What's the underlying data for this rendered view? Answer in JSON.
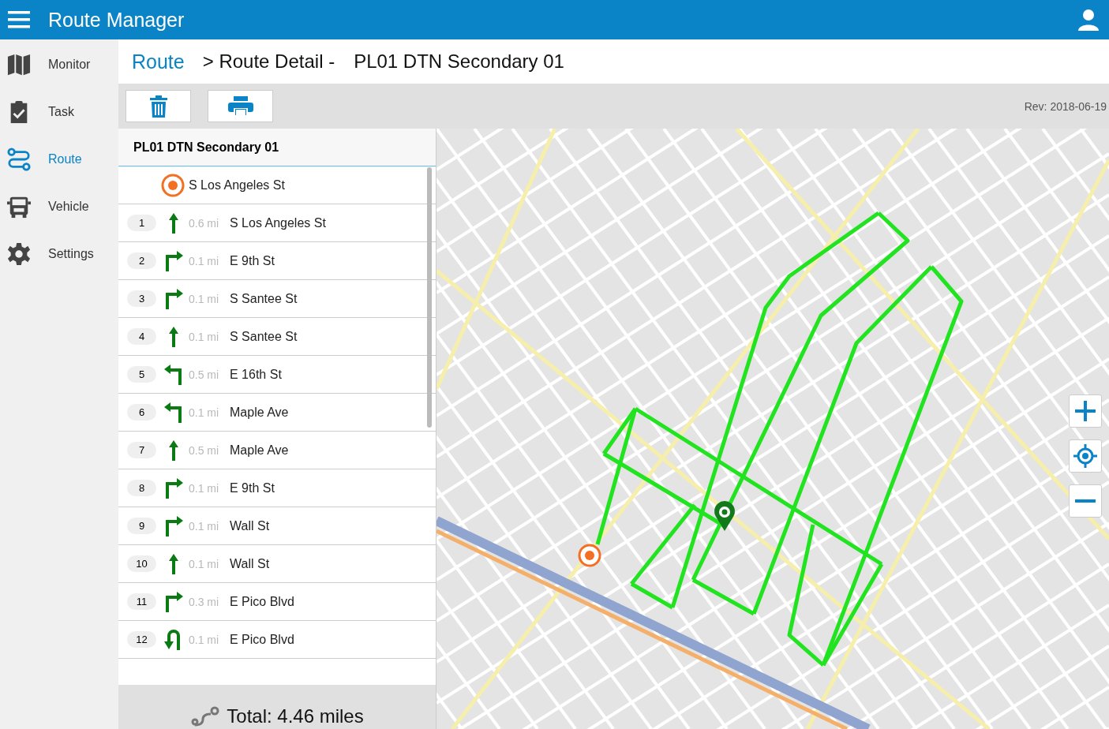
{
  "app": {
    "title": "Route Manager"
  },
  "nav": [
    {
      "label": "Monitor",
      "kind": "map",
      "selected": false
    },
    {
      "label": "Task",
      "kind": "task",
      "selected": false
    },
    {
      "label": "Route",
      "kind": "route",
      "selected": true
    },
    {
      "label": "Vehicle",
      "kind": "vehicle",
      "selected": false
    },
    {
      "label": "Settings",
      "kind": "settings",
      "selected": false
    }
  ],
  "breadcrumb": {
    "link": "Route",
    "separator": "> Route Detail -",
    "current": "PL01 DTN Secondary 01"
  },
  "toolbar": {
    "revision": "Rev: 2018-06-19"
  },
  "route": {
    "name": "PL01 DTN Secondary 01",
    "start": "S Los Angeles St",
    "steps": [
      {
        "number": "1",
        "kind": "straight",
        "distance": "0.6 mi",
        "street": "S Los Angeles St"
      },
      {
        "number": "2",
        "kind": "right",
        "distance": "0.1 mi",
        "street": "E 9th St"
      },
      {
        "number": "3",
        "kind": "right",
        "distance": "0.1 mi",
        "street": "S Santee St"
      },
      {
        "number": "4",
        "kind": "straight",
        "distance": "0.1 mi",
        "street": "S Santee St"
      },
      {
        "number": "5",
        "kind": "left",
        "distance": "0.5 mi",
        "street": "E 16th St"
      },
      {
        "number": "6",
        "kind": "left",
        "distance": "0.1 mi",
        "street": "Maple Ave"
      },
      {
        "number": "7",
        "kind": "straight",
        "distance": "0.5 mi",
        "street": "Maple Ave"
      },
      {
        "number": "8",
        "kind": "right",
        "distance": "0.1 mi",
        "street": "E 9th St"
      },
      {
        "number": "9",
        "kind": "right",
        "distance": "0.1 mi",
        "street": "Wall St"
      },
      {
        "number": "10",
        "kind": "straight",
        "distance": "0.1 mi",
        "street": "Wall St"
      },
      {
        "number": "11",
        "kind": "right",
        "distance": "0.3 mi",
        "street": "E Pico Blvd"
      },
      {
        "number": "12",
        "kind": "uturn",
        "distance": "0.1 mi",
        "street": "E Pico Blvd"
      }
    ],
    "total": "Total: 4.46 miles"
  }
}
